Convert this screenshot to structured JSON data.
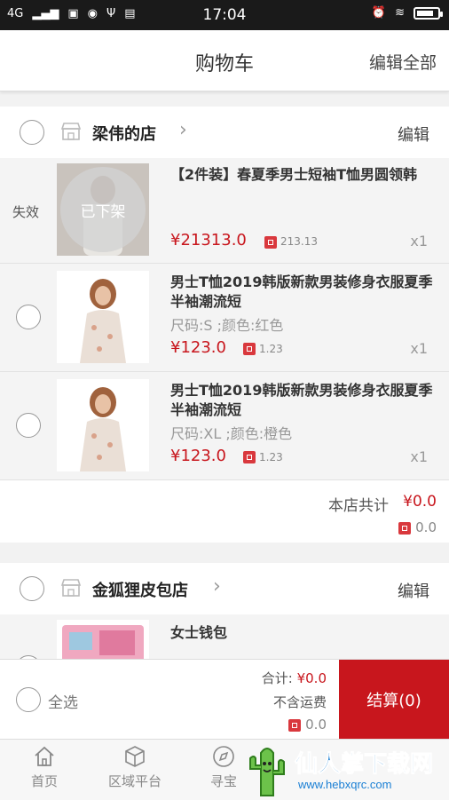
{
  "status_bar": {
    "network": "4G",
    "time": "17:04"
  },
  "header": {
    "title": "购物车",
    "edit_all": "编辑全部"
  },
  "shops": [
    {
      "name": "梁伟的店",
      "edit": "编辑",
      "items": [
        {
          "invalid_label": "失效",
          "overlay": "已下架",
          "name": "【2件装】春夏季男士短袖T恤男圆领韩",
          "price": "¥21313.0",
          "points": "213.13",
          "qty": "x1"
        },
        {
          "name": "男士T恤2019韩版新款男装修身衣服夏季半袖潮流短",
          "spec": "尺码:S ;颜色:红色",
          "price": "¥123.0",
          "points": "1.23",
          "qty": "x1"
        },
        {
          "name": "男士T恤2019韩版新款男装修身衣服夏季半袖潮流短",
          "spec": "尺码:XL ;颜色:橙色",
          "price": "¥123.0",
          "points": "1.23",
          "qty": "x1"
        }
      ],
      "total_label": "本店共计",
      "total_value": "¥0.0",
      "total_points": "0.0"
    },
    {
      "name": "金狐狸皮包店",
      "edit": "编辑",
      "items": [
        {
          "name": "女士钱包"
        }
      ]
    }
  ],
  "bottom_bar": {
    "select_all": "全选",
    "sum_label": "合计:",
    "sum_value": "¥0.0",
    "shipping_note": "不含运费",
    "points": "0.0",
    "checkout": "结算(0)"
  },
  "tabs": [
    {
      "label": "首页"
    },
    {
      "label": "区域平台"
    },
    {
      "label": "寻宝"
    }
  ],
  "watermark": {
    "text": "仙人掌下载网",
    "url": "www.hebxqrc.com"
  },
  "colors": {
    "accent": "#c8161d",
    "status_bar": "#1a1a1a"
  }
}
